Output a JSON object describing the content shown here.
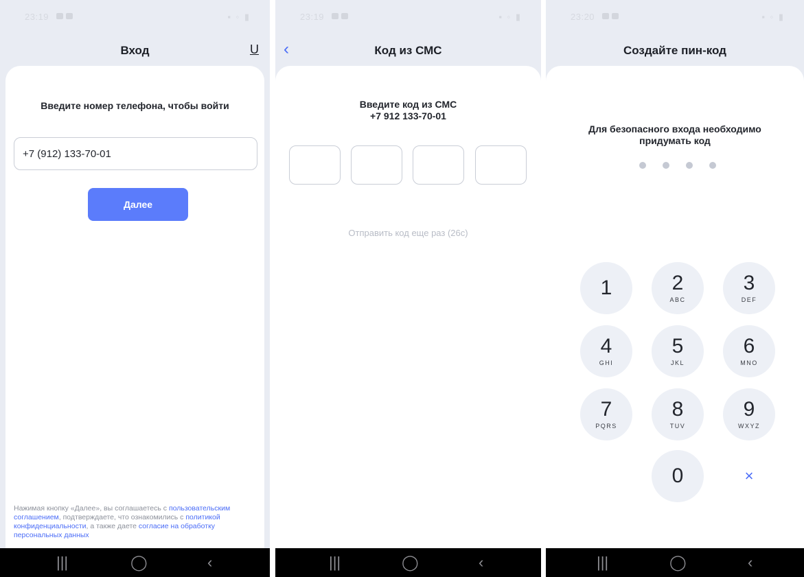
{
  "screens": [
    {
      "status_time": "23:19",
      "title": "Вход",
      "header_action": "U",
      "prompt": "Введите номер телефона, чтобы войти",
      "phone_value": "+7 (912) 133-70-01",
      "next_label": "Далее",
      "legal": {
        "t1": "Нажимая кнопку «Далее», вы соглашаетесь с ",
        "l1": "пользовательским соглашением",
        "t2": ", подтверждаете, что ознакомились с ",
        "l2": "политикой конфиденциальности",
        "t3": ", а также даете ",
        "l3": "согласие на обработку персональных данных"
      }
    },
    {
      "status_time": "23:19",
      "back_icon": "‹",
      "title": "Код из СМС",
      "prompt_line1": "Введите код из СМС",
      "prompt_line2": "+7 912 133-70-01",
      "resend": "Отправить код еще раз (26с)"
    },
    {
      "status_time": "23:20",
      "title": "Создайте пин-код",
      "prompt_line1": "Для безопасного входа необходимо",
      "prompt_line2": "придумать код",
      "keys": [
        {
          "num": "1",
          "letters": ""
        },
        {
          "num": "2",
          "letters": "ABC"
        },
        {
          "num": "3",
          "letters": "DEF"
        },
        {
          "num": "4",
          "letters": "GHI"
        },
        {
          "num": "5",
          "letters": "JKL"
        },
        {
          "num": "6",
          "letters": "MNO"
        },
        {
          "num": "7",
          "letters": "PQRS"
        },
        {
          "num": "8",
          "letters": "TUV"
        },
        {
          "num": "9",
          "letters": "WXYZ"
        },
        {
          "num": "0",
          "letters": ""
        }
      ],
      "delete_icon": "×"
    }
  ],
  "navbar": {
    "recents": "|||",
    "home": "◯",
    "back": "‹"
  },
  "colors": {
    "accent": "#5b7cfb",
    "link": "#4a6cf7",
    "background": "#e9ecf3",
    "keypad": "#edf0f6"
  }
}
